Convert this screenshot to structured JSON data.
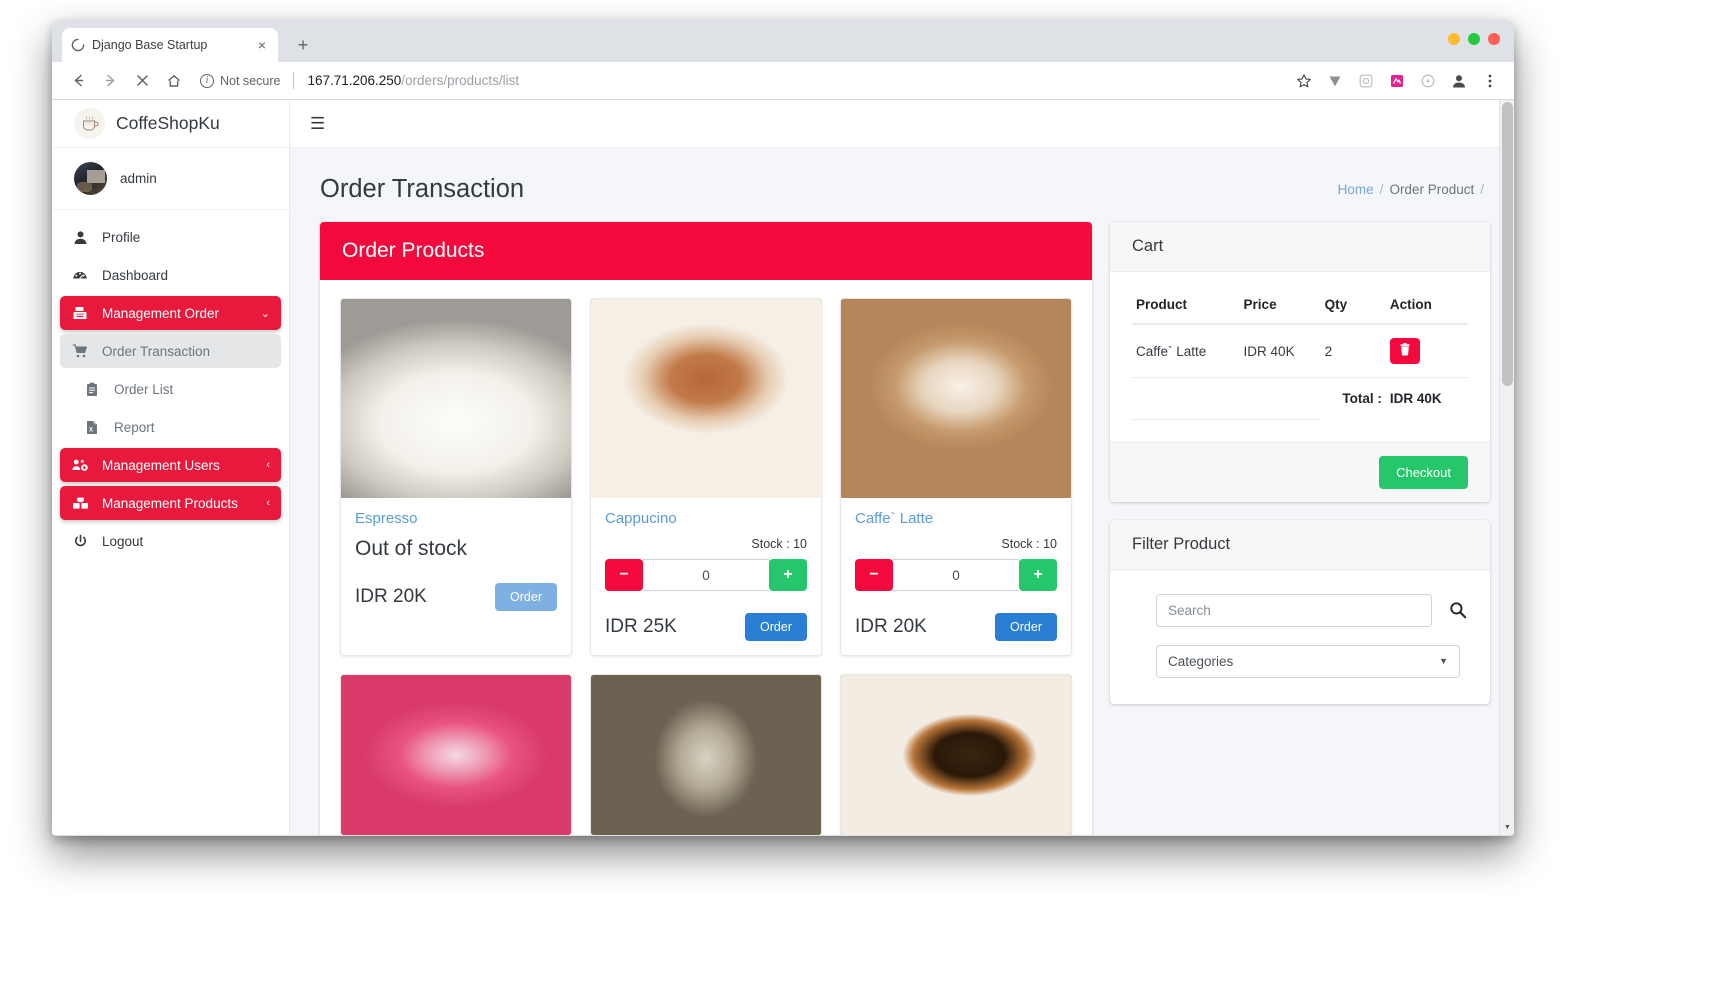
{
  "browser": {
    "tab_title": "Django Base Startup",
    "tab_close_glyph": "×",
    "new_tab_glyph": "+",
    "back_glyph": "←",
    "forward_glyph": "→",
    "stop_glyph": "✕",
    "home_glyph": "⌂",
    "info_glyph": "i",
    "security_label": "Not secure",
    "url_host": "167.71.206.250",
    "url_path": "/orders/products/list"
  },
  "sidebar": {
    "brand": "CoffeShopKu",
    "brand_icon": "☕",
    "user": "admin",
    "items": [
      {
        "label": "Profile",
        "icon": "user-icon",
        "style": "plain"
      },
      {
        "label": "Dashboard",
        "icon": "dashboard-icon",
        "style": "plain"
      },
      {
        "label": "Management Order",
        "icon": "cash-register-icon",
        "style": "red",
        "chevron": "⌄"
      },
      {
        "label": "Order Transaction",
        "icon": "shopping-cart-icon",
        "style": "active-sub"
      },
      {
        "label": "Order List",
        "icon": "clipboard-icon",
        "style": "sub"
      },
      {
        "label": "Report",
        "icon": "excel-file-icon",
        "style": "sub"
      },
      {
        "label": "Management Users",
        "icon": "users-cog-icon",
        "style": "red",
        "chevron": "‹"
      },
      {
        "label": "Management Products",
        "icon": "boxes-icon",
        "style": "red",
        "chevron": "‹"
      },
      {
        "label": "Logout",
        "icon": "power-icon",
        "style": "plain"
      }
    ]
  },
  "topbar": {
    "menu_toggle_glyph": "☰"
  },
  "page": {
    "title": "Order Transaction",
    "breadcrumb": [
      {
        "label": "Home",
        "link": true
      },
      {
        "label": "/",
        "sep": true
      },
      {
        "label": "Order Product",
        "link": false
      },
      {
        "label": "/",
        "sep": true
      }
    ]
  },
  "products_card": {
    "header": "Order Products",
    "items": [
      {
        "name": "Espresso",
        "out_of_stock_text": "Out of stock",
        "has_stock": false,
        "price": "IDR 20K",
        "order_label": "Order",
        "order_disabled": true,
        "img": "espresso"
      },
      {
        "name": "Cappucino",
        "stock_label": "Stock : 10",
        "qty": "0",
        "has_stock": true,
        "price": "IDR 25K",
        "order_label": "Order",
        "order_disabled": false,
        "img": "cappucino"
      },
      {
        "name": "Caffe` Latte",
        "stock_label": "Stock : 10",
        "qty": "0",
        "has_stock": true,
        "price": "IDR 20K",
        "order_label": "Order",
        "order_disabled": false,
        "img": "latte"
      },
      {
        "img": "pinklatte",
        "image_only": true
      },
      {
        "img": "vietnamdrip",
        "image_only": true
      },
      {
        "img": "blackcoffee",
        "image_only": true
      }
    ],
    "minus_glyph": "−",
    "plus_glyph": "+"
  },
  "cart": {
    "title": "Cart",
    "columns": [
      "Product",
      "Price",
      "Qty",
      "Action"
    ],
    "rows": [
      {
        "product": "Caffe` Latte",
        "price": "IDR 40K",
        "qty": "2"
      }
    ],
    "total_label": "Total :",
    "total_value": "IDR 40K",
    "checkout_label": "Checkout",
    "delete_icon": "trash-icon"
  },
  "filter": {
    "title": "Filter Product",
    "search_placeholder": "Search",
    "search_value": "",
    "search_icon": "search-icon",
    "category_selected": "Categories",
    "category_options": [
      "Categories"
    ],
    "caret_glyph": "▼"
  },
  "colors": {
    "brand_red": "#e8193c",
    "header_red": "#f4093c",
    "green": "#26c76a",
    "blue": "#2a7fd4",
    "link_blue": "#5b9bd5",
    "page_bg": "#f4f6f9"
  }
}
